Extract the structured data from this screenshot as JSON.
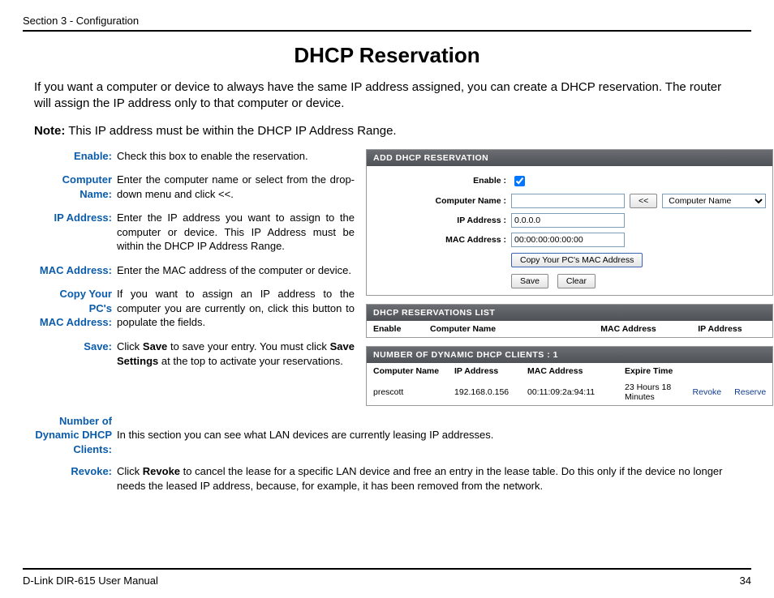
{
  "header": {
    "section": "Section 3 - Configuration"
  },
  "title": "DHCP Reservation",
  "intro": "If you want a computer or device to always have the same IP address assigned, you can create a DHCP reservation. The router will assign the IP address only to that computer or device.",
  "note_label": "Note:",
  "note_text": " This IP address must be within the DHCP IP Address Range.",
  "defs": {
    "enable": {
      "term": "Enable:",
      "desc": "Check this box to enable the reservation."
    },
    "cname": {
      "term": "Computer Name:",
      "desc": "Enter the computer name or select from the drop-down menu and click <<."
    },
    "ip": {
      "term": "IP Address:",
      "desc": "Enter the IP address you want to assign to the computer or device. This IP Address must be within the DHCP IP Address Range."
    },
    "mac": {
      "term": "MAC Address:",
      "desc": "Enter the MAC address of the computer or device."
    },
    "copy": {
      "term1": "Copy Your PC's",
      "term2": "MAC Address:",
      "desc": "If you want to assign an IP address to the computer you are currently on, click this button to populate the fields."
    },
    "save": {
      "term": "Save:",
      "pre": "Click ",
      "b1": "Save",
      "mid": " to save your entry. You must click ",
      "b2": "Save Settings",
      "post": " at the top to activate your reservations."
    },
    "num": {
      "term1": "Number of",
      "term2": "Dynamic DHCP",
      "term3": "Clients:",
      "desc": "In this section you can see what LAN devices are currently leasing IP addresses."
    },
    "revoke": {
      "term": "Revoke:",
      "pre": "Click ",
      "b1": "Revoke",
      "post": " to cancel the lease for a specific LAN device and free an entry in the lease table. Do this only if the device no longer needs the leased IP address, because, for example, it has been removed from the network."
    }
  },
  "panel": {
    "add_hd": "ADD DHCP RESERVATION",
    "enable_lbl": "Enable :",
    "cname_lbl": "Computer Name :",
    "ip_lbl": "IP Address :",
    "ip_val": "0.0.0.0",
    "mac_lbl": "MAC Address :",
    "mac_val": "00:00:00:00:00:00",
    "lt": "<<",
    "cn_placeholder": "Computer Name",
    "copy_btn": "Copy Your PC's MAC Address",
    "save_btn": "Save",
    "clear_btn": "Clear",
    "list_hd": "DHCP RESERVATIONS LIST",
    "list_cols": {
      "c1": "Enable",
      "c2": "Computer Name",
      "c3": "MAC Address",
      "c4": "IP Address"
    },
    "clients_hd": "NUMBER OF DYNAMIC DHCP CLIENTS : 1",
    "clients_cols": {
      "c1": "Computer Name",
      "c2": "IP Address",
      "c3": "MAC Address",
      "c4": "Expire Time"
    },
    "clients_row": {
      "c1": "prescott",
      "c2": "192.168.0.156",
      "c3": "00:11:09:2a:94:11",
      "c4": "23 Hours 18 Minutes",
      "a1": "Revoke",
      "a2": "Reserve"
    }
  },
  "footer": {
    "left": "D-Link DIR-615 User Manual",
    "right": "34"
  }
}
